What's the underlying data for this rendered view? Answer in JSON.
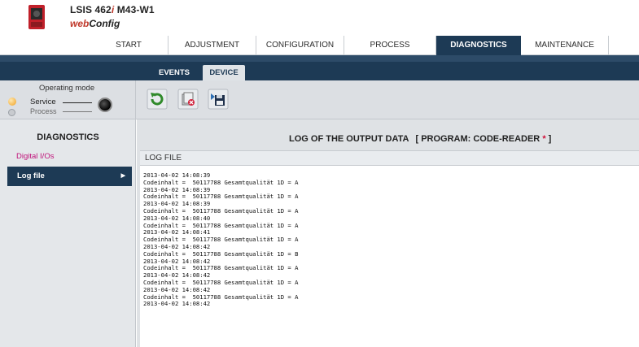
{
  "header": {
    "product_prefix": "LSIS 462",
    "product_italic": "i",
    "product_suffix": " M43-W1",
    "app_web": "web",
    "app_config": "Config"
  },
  "main_tabs": [
    "START",
    "ADJUSTMENT",
    "CONFIGURATION",
    "PROCESS",
    "DIAGNOSTICS",
    "MAINTENANCE"
  ],
  "active_main_tab": "DIAGNOSTICS",
  "sub_tabs": [
    "EVENTS",
    "DEVICE"
  ],
  "active_sub_tab": "DEVICE",
  "operating_mode": {
    "title": "Operating mode",
    "service": "Service",
    "process": "Process"
  },
  "toolbar_icons": [
    "refresh-icon",
    "delete-icon",
    "save-icon"
  ],
  "sidebar": {
    "title": "DIAGNOSTICS",
    "items": [
      "Digital I/Os",
      "Log file"
    ]
  },
  "content": {
    "title": "LOG OF THE OUTPUT DATA",
    "program_label": "[ PROGRAM: CODE-READER ",
    "program_star": "*",
    "program_close": " ]",
    "log_header": "LOG FILE",
    "log_lines": [
      "2013-04-02 14:08:39",
      "Codeinhalt =  50117788 Gesamtqualität 1D = A",
      "2013-04-02 14:08:39",
      "Codeinhalt =  50117788 Gesamtqualität 1D = A",
      "2013-04-02 14:08:39",
      "Codeinhalt =  50117788 Gesamtqualität 1D = A",
      "2013-04-02 14:08:40",
      "Codeinhalt =  50117788 Gesamtqualität 1D = A",
      "2013-04-02 14:08:41",
      "Codeinhalt =  50117788 Gesamtqualität 1D = A",
      "2013-04-02 14:08:42",
      "Codeinhalt =  50117788 Gesamtqualität 1D = B",
      "2013-04-02 14:08:42",
      "Codeinhalt =  50117788 Gesamtqualität 1D = A",
      "2013-04-02 14:08:42",
      "Codeinhalt =  50117788 Gesamtqualität 1D = A",
      "2013-04-02 14:08:42",
      "Codeinhalt =  50117788 Gesamtqualität 1D = A",
      "2013-04-02 14:08:42"
    ]
  },
  "colors": {
    "navy": "#1d3a55",
    "accent_red": "#c0392b",
    "link_magenta": "#c0127a"
  }
}
